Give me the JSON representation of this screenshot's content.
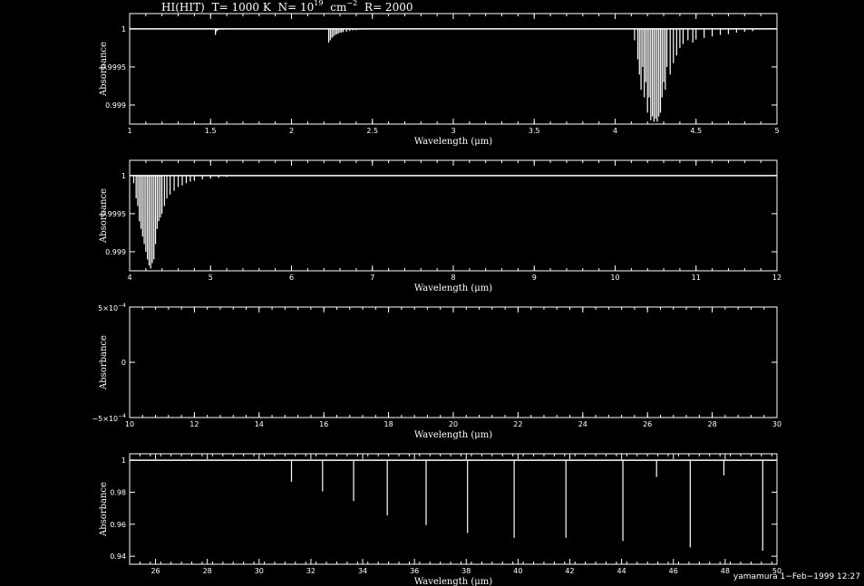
{
  "title": {
    "species": "HI(HIT)",
    "temperature": "T= 1000 K",
    "column_density_prefix": "N= 10",
    "column_density_exponent": "19",
    "column_density_unit": "cm",
    "column_density_unit_exponent": "−2",
    "resolution": "R= 2000"
  },
  "footer": {
    "stamp": "yamamura  1−Feb−1999 12:27"
  },
  "colors": {
    "background": "#000000",
    "foreground": "#ffffff"
  },
  "chart_data": [
    {
      "type": "line",
      "xlabel": "Wavelength (μm)",
      "ylabel": "Absorbance",
      "xlim": [
        1,
        5
      ],
      "ylim": [
        0.99875,
        1.0002
      ],
      "x_ticks": [
        1,
        1.5,
        2,
        2.5,
        3,
        3.5,
        4,
        4.5,
        5
      ],
      "x_tick_labels": [
        "1",
        "1.5",
        "2",
        "2.5",
        "3",
        "3.5",
        "4",
        "4.5",
        "5"
      ],
      "y_ticks": [
        1,
        0.9995,
        0.999
      ],
      "y_tick_labels": [
        "1",
        "0.9995",
        "0.999"
      ],
      "lines": {
        "x": [
          1.53,
          1.532,
          1.535,
          1.54,
          1.545,
          1.55,
          1.56,
          1.57,
          1.58,
          1.59,
          1.6,
          2.23,
          2.24,
          2.25,
          2.26,
          2.27,
          2.28,
          2.29,
          2.3,
          2.31,
          2.32,
          2.34,
          2.36,
          2.38,
          2.4,
          2.42,
          2.45,
          4.12,
          4.14,
          4.15,
          4.16,
          4.17,
          4.18,
          4.19,
          4.2,
          4.21,
          4.22,
          4.23,
          4.24,
          4.25,
          4.26,
          4.27,
          4.28,
          4.29,
          4.3,
          4.31,
          4.32,
          4.34,
          4.36,
          4.38,
          4.4,
          4.42,
          4.45,
          4.48,
          4.5,
          4.55,
          4.6,
          4.65,
          4.7,
          4.75,
          4.8,
          4.85
        ],
        "y": [
          0.99992,
          0.99995,
          0.99997,
          0.99998,
          0.99998,
          0.99999,
          0.99999,
          0.99999,
          0.99999,
          1.0,
          1.0,
          0.99982,
          0.99985,
          0.99988,
          0.9999,
          0.99992,
          0.99993,
          0.99994,
          0.99995,
          0.99995,
          0.99996,
          0.99996,
          0.99997,
          0.99998,
          0.99998,
          0.99999,
          0.99999,
          0.99985,
          0.9996,
          0.9994,
          0.9992,
          0.9995,
          0.9991,
          0.9993,
          0.9989,
          0.9991,
          0.9988,
          0.99885,
          0.99878,
          0.99882,
          0.99878,
          0.99885,
          0.9989,
          0.9991,
          0.9993,
          0.9992,
          0.9995,
          0.9994,
          0.99955,
          0.99965,
          0.99975,
          0.9998,
          0.99985,
          0.99982,
          0.99986,
          0.99988,
          0.9999,
          0.99992,
          0.99993,
          0.99995,
          0.99996,
          0.99997
        ]
      }
    },
    {
      "type": "line",
      "xlabel": "Wavelength (μm)",
      "ylabel": "Absorbance",
      "xlim": [
        4,
        12
      ],
      "ylim": [
        0.99875,
        1.0002
      ],
      "x_ticks": [
        4,
        5,
        6,
        7,
        8,
        9,
        10,
        11,
        12
      ],
      "x_tick_labels": [
        "4",
        "5",
        "6",
        "7",
        "8",
        "9",
        "10",
        "11",
        "12"
      ],
      "y_ticks": [
        1,
        0.9995,
        0.999
      ],
      "y_tick_labels": [
        "1",
        "0.9995",
        "0.999"
      ],
      "lines": {
        "x": [
          4.05,
          4.08,
          4.1,
          4.12,
          4.14,
          4.16,
          4.18,
          4.2,
          4.22,
          4.24,
          4.26,
          4.28,
          4.3,
          4.32,
          4.34,
          4.36,
          4.38,
          4.4,
          4.43,
          4.46,
          4.5,
          4.55,
          4.6,
          4.65,
          4.7,
          4.75,
          4.8,
          4.9,
          5.0,
          5.1,
          5.2,
          5.3,
          5.4
        ],
        "y": [
          0.9999,
          0.9997,
          0.9996,
          0.9994,
          0.9993,
          0.9992,
          0.9991,
          0.999,
          0.9989,
          0.99882,
          0.99878,
          0.99885,
          0.9989,
          0.9991,
          0.9993,
          0.9994,
          0.99945,
          0.9995,
          0.9996,
          0.9997,
          0.99975,
          0.9998,
          0.99985,
          0.99987,
          0.9999,
          0.99992,
          0.99993,
          0.99995,
          0.99996,
          0.99997,
          0.99998,
          0.99999,
          1.0
        ]
      }
    },
    {
      "type": "line",
      "xlabel": "Wavelength (μm)",
      "ylabel": "Absorbance",
      "xlim": [
        10,
        30
      ],
      "ylim": [
        -0.0005,
        0.0005
      ],
      "x_ticks": [
        10,
        12,
        14,
        16,
        18,
        20,
        22,
        24,
        26,
        28,
        30
      ],
      "x_tick_labels": [
        "10",
        "12",
        "14",
        "16",
        "18",
        "20",
        "22",
        "24",
        "26",
        "28",
        "30"
      ],
      "y_ticks": [
        0.0005,
        0,
        -0.0005
      ],
      "y_tick_labels": [
        "5×10",
        "0",
        "−5×10"
      ],
      "y_tick_exponents": [
        "−4",
        "",
        "−4"
      ],
      "lines": {
        "x": [],
        "y": []
      }
    },
    {
      "type": "line",
      "xlabel": "Wavelength (μm)",
      "ylabel": "Absorbance",
      "xlim": [
        25,
        50
      ],
      "ylim": [
        0.935,
        1.004
      ],
      "x_ticks": [
        26,
        28,
        30,
        32,
        34,
        36,
        38,
        40,
        42,
        44,
        46,
        48,
        50
      ],
      "x_tick_labels": [
        "26",
        "28",
        "30",
        "32",
        "34",
        "36",
        "38",
        "40",
        "42",
        "44",
        "46",
        "48",
        "50"
      ],
      "y_ticks": [
        1,
        0.98,
        0.96,
        0.94
      ],
      "y_tick_labels": [
        "1",
        "0.98",
        "0.96",
        "0.94"
      ],
      "lines": {
        "x": [
          31.25,
          32.45,
          33.65,
          34.95,
          36.45,
          38.05,
          39.85,
          41.85,
          44.05,
          45.35,
          46.65,
          47.95,
          49.45
        ],
        "y": [
          0.9865,
          0.9805,
          0.9745,
          0.9655,
          0.9595,
          0.9545,
          0.9515,
          0.9515,
          0.9495,
          0.9895,
          0.9455,
          0.9905,
          0.9435
        ]
      }
    }
  ]
}
